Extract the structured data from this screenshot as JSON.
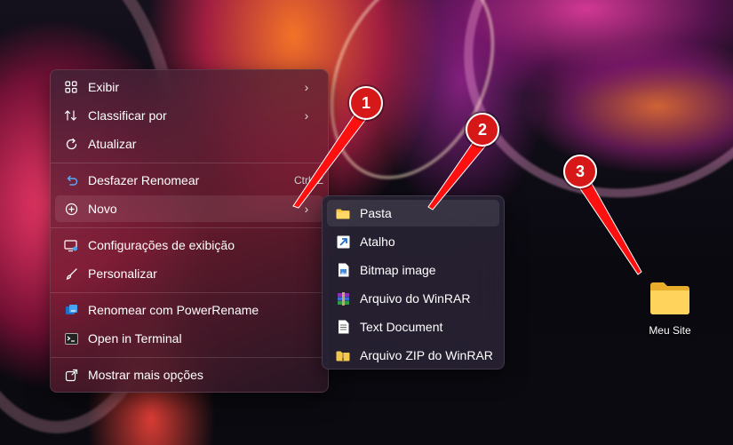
{
  "main_menu": {
    "items": [
      {
        "label": "Exibir",
        "icon": "grid-icon",
        "has_submenu": true
      },
      {
        "label": "Classificar por",
        "icon": "sort-arrows-icon",
        "has_submenu": true
      },
      {
        "label": "Atualizar",
        "icon": "refresh-icon",
        "has_submenu": false
      },
      {
        "label": "Desfazer Renomear",
        "icon": "undo-icon",
        "shortcut": "Ctrl+Z"
      },
      {
        "label": "Novo",
        "icon": "plus-circle-icon",
        "has_submenu": true
      },
      {
        "label": "Configurações de exibição",
        "icon": "display-settings-icon"
      },
      {
        "label": "Personalizar",
        "icon": "brush-icon"
      },
      {
        "label": "Renomear com PowerRename",
        "icon": "powerrename-icon"
      },
      {
        "label": "Open in Terminal",
        "icon": "terminal-icon"
      },
      {
        "label": "Mostrar mais opções",
        "icon": "share-more-icon"
      }
    ]
  },
  "new_submenu": {
    "items": [
      {
        "label": "Pasta",
        "icon": "folder-icon"
      },
      {
        "label": "Atalho",
        "icon": "shortcut-arrow-icon"
      },
      {
        "label": "Bitmap image",
        "icon": "bitmap-icon"
      },
      {
        "label": "Arquivo do WinRAR",
        "icon": "winrar-icon"
      },
      {
        "label": "Text Document",
        "icon": "text-document-icon"
      },
      {
        "label": "Arquivo ZIP do WinRAR",
        "icon": "winrar-zip-icon"
      }
    ]
  },
  "desktop": {
    "folder_label": "Meu Site"
  },
  "callouts": [
    "1",
    "2",
    "3"
  ],
  "colors": {
    "callout_red": "#d71818",
    "folder_yellow": "#f5c542",
    "accent_blue": "#4aa3f0"
  }
}
